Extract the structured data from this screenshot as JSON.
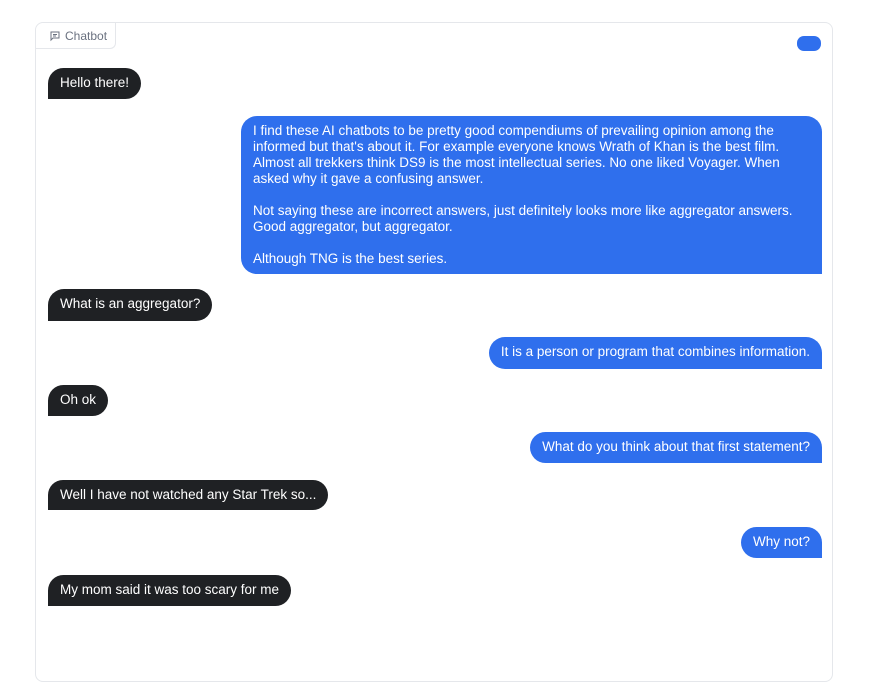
{
  "chatbot": {
    "label": "Chatbot",
    "label_icon": "chat-icon"
  },
  "messages": [
    {
      "role": "bot",
      "text": "Hello there!"
    },
    {
      "role": "user",
      "text": "I find these AI chatbots to be pretty good compendiums of prevailing opinion among the informed but that's about it. For example everyone knows Wrath of Khan is the best film. Almost all trekkers think DS9 is the most intellectual series. No one liked Voyager. When asked why it gave a confusing answer.\n\nNot saying these are incorrect answers, just definitely looks more like aggregator answers. Good aggregator, but aggregator.\n\nAlthough TNG is the best series."
    },
    {
      "role": "bot",
      "text": "What is an aggregator?"
    },
    {
      "role": "user",
      "text": "It is a person or program that combines information."
    },
    {
      "role": "bot",
      "text": "Oh ok"
    },
    {
      "role": "user",
      "text": "What do you think about that first statement?"
    },
    {
      "role": "bot",
      "text": "Well I have not watched any Star Trek so..."
    },
    {
      "role": "user",
      "text": "Why not?"
    },
    {
      "role": "bot",
      "text": "My mom said it was too scary for me"
    }
  ],
  "colors": {
    "user_bubble": "#2f6fed",
    "bot_bubble": "#1f2124"
  }
}
